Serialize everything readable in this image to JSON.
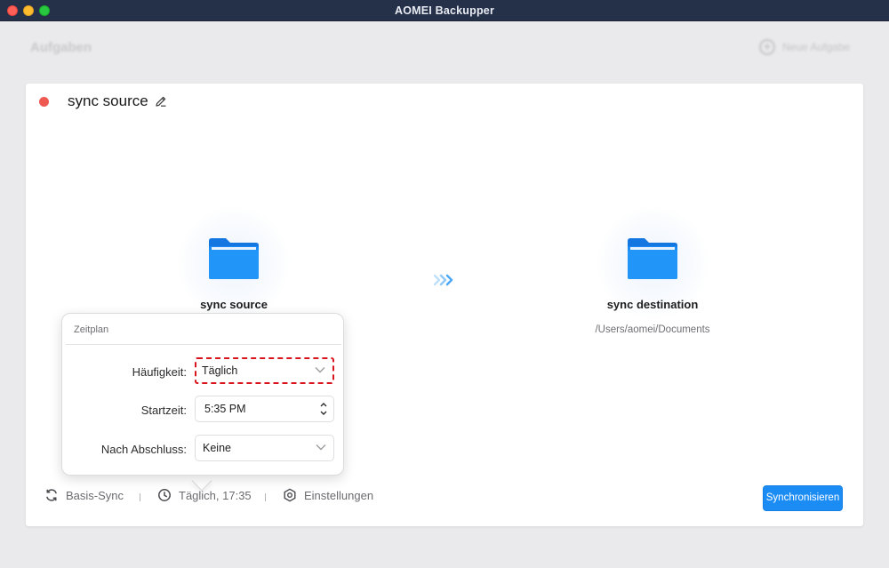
{
  "window": {
    "title": "AOMEI Backupper"
  },
  "page": {
    "title": "Aufgaben",
    "new_task_label": "Neue Aufgabe"
  },
  "task": {
    "name": "sync source",
    "source": {
      "title": "sync source",
      "path": ""
    },
    "destination": {
      "title": "sync destination",
      "path": "/Users/aomei/Documents"
    }
  },
  "schedule_popover": {
    "title": "Zeitplan",
    "frequency": {
      "label": "Häufigkeit:",
      "value": "Täglich"
    },
    "start_time": {
      "label": "Startzeit:",
      "value": "5:35 PM"
    },
    "after_completion": {
      "label": "Nach Abschluss:",
      "value": "Keine"
    }
  },
  "footer": {
    "sync_mode": "Basis-Sync",
    "schedule": "Täglich, 17:35",
    "settings": "Einstellungen",
    "sync_button": "Synchronisieren"
  },
  "icons": {
    "status": "status-dot",
    "edit": "pencil-icon",
    "folder": "folder-icon",
    "arrows": "triple-chevron-right-icon",
    "sync_mode": "sync-icon",
    "schedule": "clock-icon",
    "settings": "gear-icon"
  },
  "colors": {
    "titlebar": "#253049",
    "accent": "#1c8cf5",
    "status_dot": "#ee5a52",
    "highlight_border": "#d9141c",
    "folder": "#1a8af6"
  }
}
